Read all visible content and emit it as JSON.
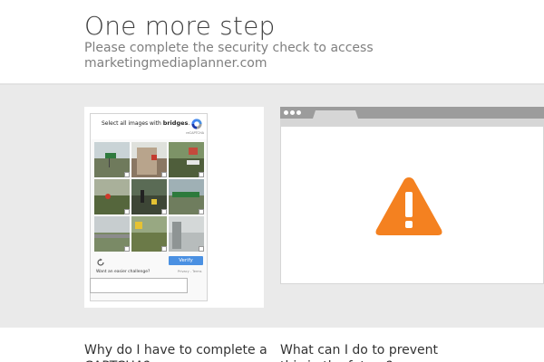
{
  "header": {
    "title": "One more step",
    "subtitle": "Please complete the security check to access marketingmediaplanner.com"
  },
  "captcha": {
    "prompt_prefix": "Select all images with ",
    "prompt_target": "bridges",
    "prompt_suffix": ".",
    "brand_label": "reCAPTCHA",
    "verify_label": "Verify",
    "easier_challenge": "Want an easier challenge?",
    "privacy_terms": "Privacy - Terms",
    "accent_color": "#4a90e2",
    "tiles": [
      {
        "name": "tile-1",
        "scene": "road-signs"
      },
      {
        "name": "tile-2",
        "scene": "building"
      },
      {
        "name": "tile-3",
        "scene": "trees-sign"
      },
      {
        "name": "tile-4",
        "scene": "street-trees"
      },
      {
        "name": "tile-5",
        "scene": "intersection"
      },
      {
        "name": "tile-6",
        "scene": "highway-sign"
      },
      {
        "name": "tile-7",
        "scene": "overpass"
      },
      {
        "name": "tile-8",
        "scene": "grass-sign"
      },
      {
        "name": "tile-9",
        "scene": "bridge-pillar"
      }
    ]
  },
  "illustration": {
    "icon": "warning-icon",
    "warning_color": "#f48120"
  },
  "faq": {
    "left_heading": "Why do I have to complete a CAPTCHA?",
    "right_heading": "What can I do to prevent this in the future?"
  }
}
